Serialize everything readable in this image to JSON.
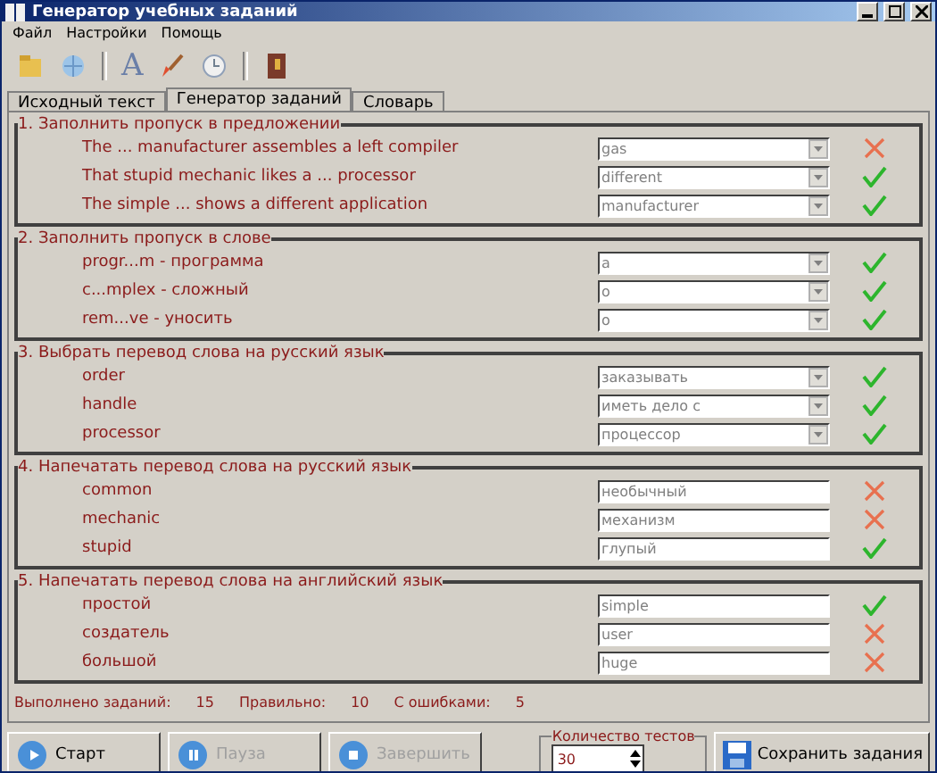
{
  "window": {
    "title": "Генератор учебных заданий"
  },
  "menu": [
    "Файл",
    "Настройки",
    "Помощь"
  ],
  "toolbar": [
    {
      "kind": "folder"
    },
    {
      "kind": "globe"
    },
    {
      "kind": "sep"
    },
    {
      "kind": "letter",
      "glyph": "A"
    },
    {
      "kind": "brush"
    },
    {
      "kind": "clock"
    },
    {
      "kind": "sep"
    },
    {
      "kind": "book"
    }
  ],
  "tabs": [
    {
      "label": "Исходный текст",
      "selected": false
    },
    {
      "label": "Генератор заданий",
      "selected": true
    },
    {
      "label": "Словарь",
      "selected": false
    }
  ],
  "sections": [
    {
      "title": "1. Заполнить пропуск в предложении",
      "kind": "combo",
      "rows": [
        {
          "prompt": "The ... manufacturer assembles a left compiler",
          "answer": "gas",
          "correct": false
        },
        {
          "prompt": "That stupid mechanic likes a ... processor",
          "answer": "different",
          "correct": true
        },
        {
          "prompt": "The simple ... shows a different application",
          "answer": "manufacturer",
          "correct": true
        }
      ]
    },
    {
      "title": "2. Заполнить пропуск в слове",
      "kind": "combo",
      "rows": [
        {
          "prompt": "progr...m - программа",
          "answer": "a",
          "correct": true
        },
        {
          "prompt": "c...mplex - сложный",
          "answer": "o",
          "correct": true
        },
        {
          "prompt": "rem...ve - уносить",
          "answer": "o",
          "correct": true
        }
      ]
    },
    {
      "title": "3. Выбрать перевод слова на русский язык",
      "kind": "combo",
      "rows": [
        {
          "prompt": "order",
          "answer": "заказывать",
          "correct": true
        },
        {
          "prompt": "handle",
          "answer": "иметь дело с",
          "correct": true
        },
        {
          "prompt": "processor",
          "answer": "процессор",
          "correct": true
        }
      ]
    },
    {
      "title": "4. Напечатать перевод слова на русский язык",
      "kind": "text",
      "rows": [
        {
          "prompt": "common",
          "answer": "необычный",
          "correct": false
        },
        {
          "prompt": "mechanic",
          "answer": "механизм",
          "correct": false
        },
        {
          "prompt": "stupid",
          "answer": "глупый",
          "correct": true
        }
      ]
    },
    {
      "title": "5. Напечатать перевод слова на английский язык",
      "kind": "text",
      "rows": [
        {
          "prompt": "простой",
          "answer": "simple",
          "correct": true
        },
        {
          "prompt": "создатель",
          "answer": "user",
          "correct": false
        },
        {
          "prompt": "большой",
          "answer": "huge",
          "correct": false
        }
      ]
    }
  ],
  "stats": [
    {
      "label": "Выполнено заданий:",
      "value": "15"
    },
    {
      "label": "Правильно:",
      "value": "10"
    },
    {
      "label": "С ошибками:",
      "value": "5"
    }
  ],
  "buttons": [
    {
      "label": "Старт",
      "kind": "play",
      "disabled": false
    },
    {
      "label": "Пауза",
      "kind": "pause",
      "disabled": true
    },
    {
      "label": "Завершить",
      "kind": "stop",
      "disabled": true
    }
  ],
  "test_count": {
    "label": "Количество тестов",
    "value": "30"
  },
  "save_button": {
    "label": "Сохранить задания"
  }
}
